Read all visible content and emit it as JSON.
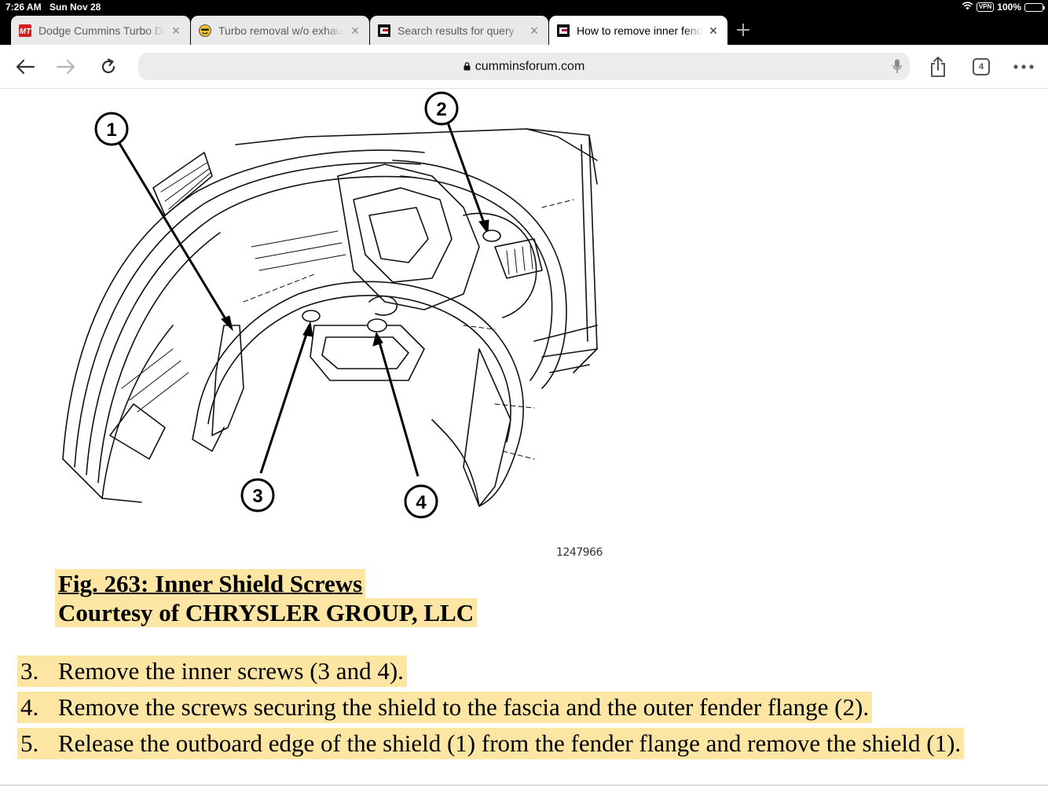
{
  "status": {
    "time": "7:26 AM",
    "date": "Sun Nov 28",
    "vpn": "VPN",
    "battery": "100%"
  },
  "tabs": [
    {
      "title": "Dodge Cummins Turbo Di",
      "icon": "mt-logo-icon",
      "active": false
    },
    {
      "title": "Turbo removal w/o exhaust",
      "icon": "smiley-icon",
      "active": false
    },
    {
      "title": "Search results for query",
      "icon": "forum-icon",
      "active": false
    },
    {
      "title": "How to remove inner fender",
      "icon": "forum-icon",
      "active": true
    }
  ],
  "toolbar": {
    "url": "cumminsforum.com",
    "tab_count": "4"
  },
  "figure": {
    "callouts": [
      "1",
      "2",
      "3",
      "4"
    ],
    "id": "1247966",
    "caption_title": "Fig. 263: Inner Shield Screws",
    "caption_courtesy": "Courtesy of CHRYSLER GROUP, LLC"
  },
  "steps": [
    {
      "num": "3.",
      "text": "Remove the inner screws (3 and 4)."
    },
    {
      "num": "4.",
      "text": "Remove the screws securing the shield to the fascia and the outer fender flange (2)."
    },
    {
      "num": "5.",
      "text": "Release the outboard edge of the shield (1) from the fender flange and remove the shield (1)."
    }
  ],
  "colors": {
    "highlight": "#fde6a4",
    "chrome": "#000000",
    "tab_inactive": "#e9e9ea"
  }
}
